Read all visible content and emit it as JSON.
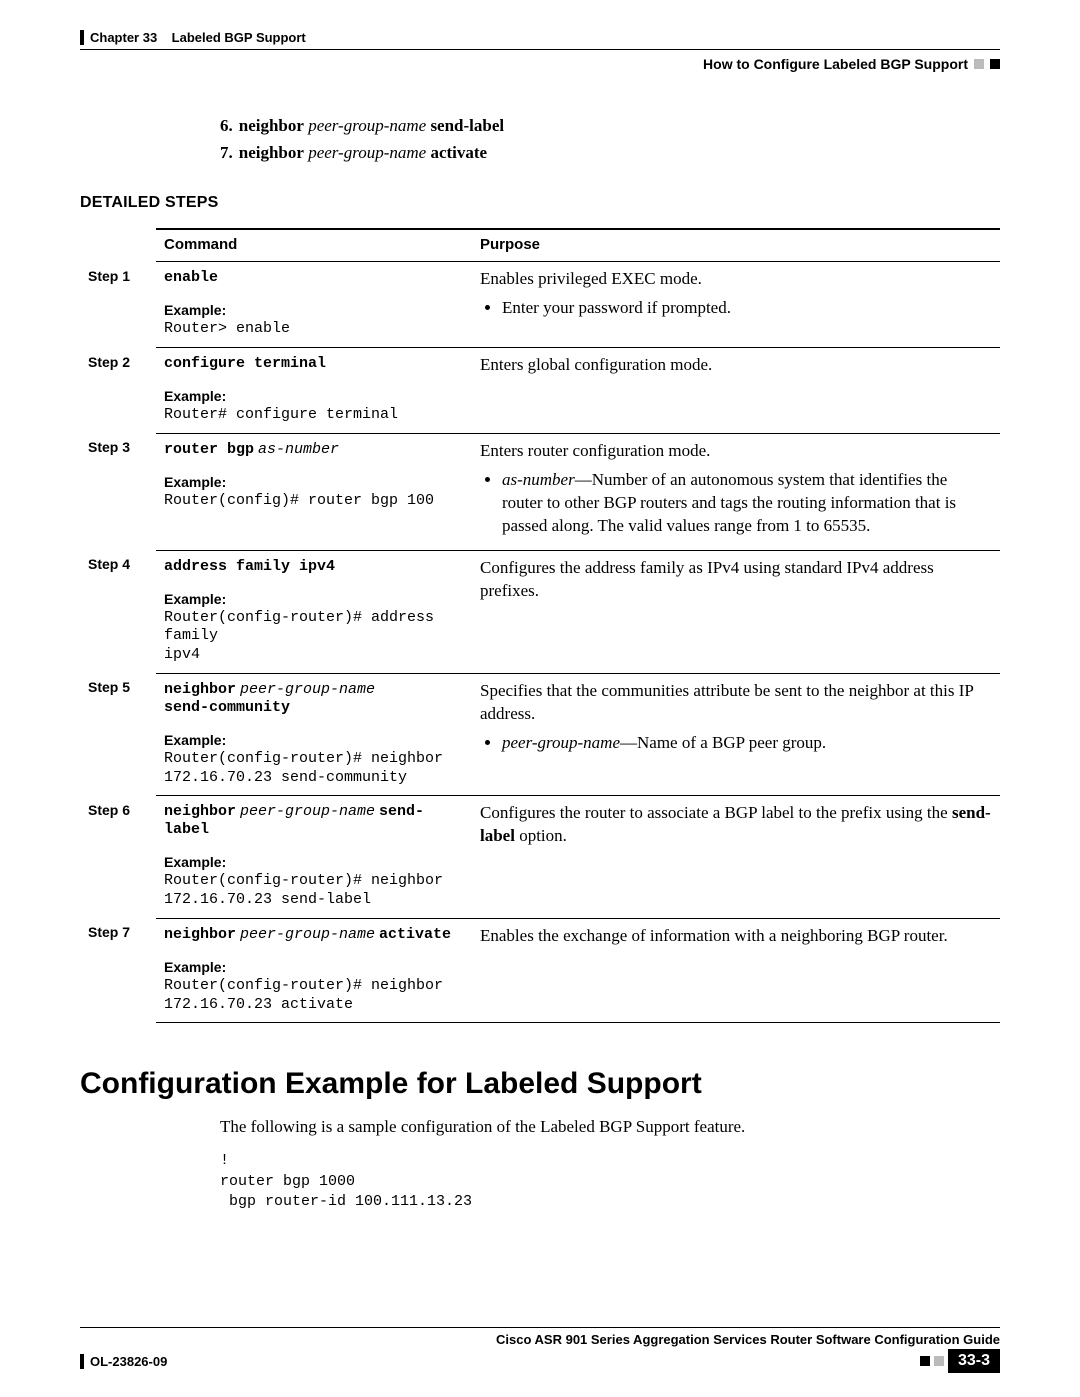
{
  "header": {
    "chapter_label": "Chapter 33",
    "chapter_title": "Labeled BGP Support",
    "section_title": "How to Configure Labeled BGP Support"
  },
  "summary_steps": [
    {
      "num": "6.",
      "kw1": "neighbor",
      "arg": "peer-group-name",
      "kw2": "send-label"
    },
    {
      "num": "7.",
      "kw1": "neighbor",
      "arg": "peer-group-name",
      "kw2": "activate"
    }
  ],
  "detailed_heading": "DETAILED STEPS",
  "table": {
    "headers": {
      "command": "Command",
      "purpose": "Purpose"
    },
    "rows": [
      {
        "step": "Step 1",
        "command_html": "<span class='cmd-bold'>enable</span>",
        "example_label": "Example:",
        "example_code": "Router> enable",
        "purpose_html": "Enables privileged EXEC mode.<ul><li>Enter your password if prompted.</li></ul>"
      },
      {
        "step": "Step 2",
        "command_html": "<span class='cmd-bold'>configure terminal</span>",
        "example_label": "Example:",
        "example_code": "Router# configure terminal",
        "purpose_html": "Enters global configuration mode."
      },
      {
        "step": "Step 3",
        "command_html": "<span class='cmd-bold'>router bgp</span> <span class='cmd-ital'>as-number</span>",
        "example_label": "Example:",
        "example_code": "Router(config)# router bgp 100",
        "purpose_html": "Enters router configuration mode.<ul><li><span class='ital'>as-number</span>—Number of an autonomous system that identifies the router to other BGP routers and tags the routing information that is passed along. The valid values range from 1 to 65535.</li></ul>"
      },
      {
        "step": "Step 4",
        "command_html": "<span class='cmd-bold'>address family ipv4</span>",
        "example_label": "Example:",
        "example_code": "Router(config-router)# address family\nipv4",
        "purpose_html": "Configures the address family as IPv4 using standard IPv4 address prefixes."
      },
      {
        "step": "Step 5",
        "command_html": "<span class='cmd-bold'>neighbor</span> <span class='cmd-ital'>peer-group-name</span><br><span class='cmd-bold'>send-community</span>",
        "example_label": "Example:",
        "example_code": "Router(config-router)# neighbor\n172.16.70.23 send-community",
        "purpose_html": "Specifies that the communities attribute be sent to the neighbor at this IP address.<ul><li><span class='ital'>peer-group-name</span>—Name of a BGP peer group.</li></ul>"
      },
      {
        "step": "Step 6",
        "command_html": "<span class='cmd-bold'>neighbor</span> <span class='cmd-ital'>peer-group-name</span> <span class='cmd-bold'>send-label</span>",
        "example_label": "Example:",
        "example_code": "Router(config-router)# neighbor\n172.16.70.23 send-label",
        "purpose_html": "Configures the router to associate a BGP label to the prefix using the <span class='bold'>send-label</span> option."
      },
      {
        "step": "Step 7",
        "command_html": "<span class='cmd-bold'>neighbor</span> <span class='cmd-ital'>peer-group-name</span> <span class='cmd-bold'>activate</span>",
        "example_label": "Example:",
        "example_code": "Router(config-router)# neighbor\n172.16.70.23 activate",
        "purpose_html": "Enables the exchange of information with a neighboring BGP router."
      }
    ]
  },
  "h1": "Configuration Example for Labeled Support",
  "intro_para": "The following is a sample configuration of the Labeled BGP Support feature.",
  "config_code": "!\nrouter bgp 1000\n bgp router-id 100.111.13.23",
  "footer": {
    "guide_title": "Cisco ASR 901 Series Aggregation Services Router Software Configuration Guide",
    "doc_id": "OL-23826-09",
    "page_num": "33-3"
  }
}
